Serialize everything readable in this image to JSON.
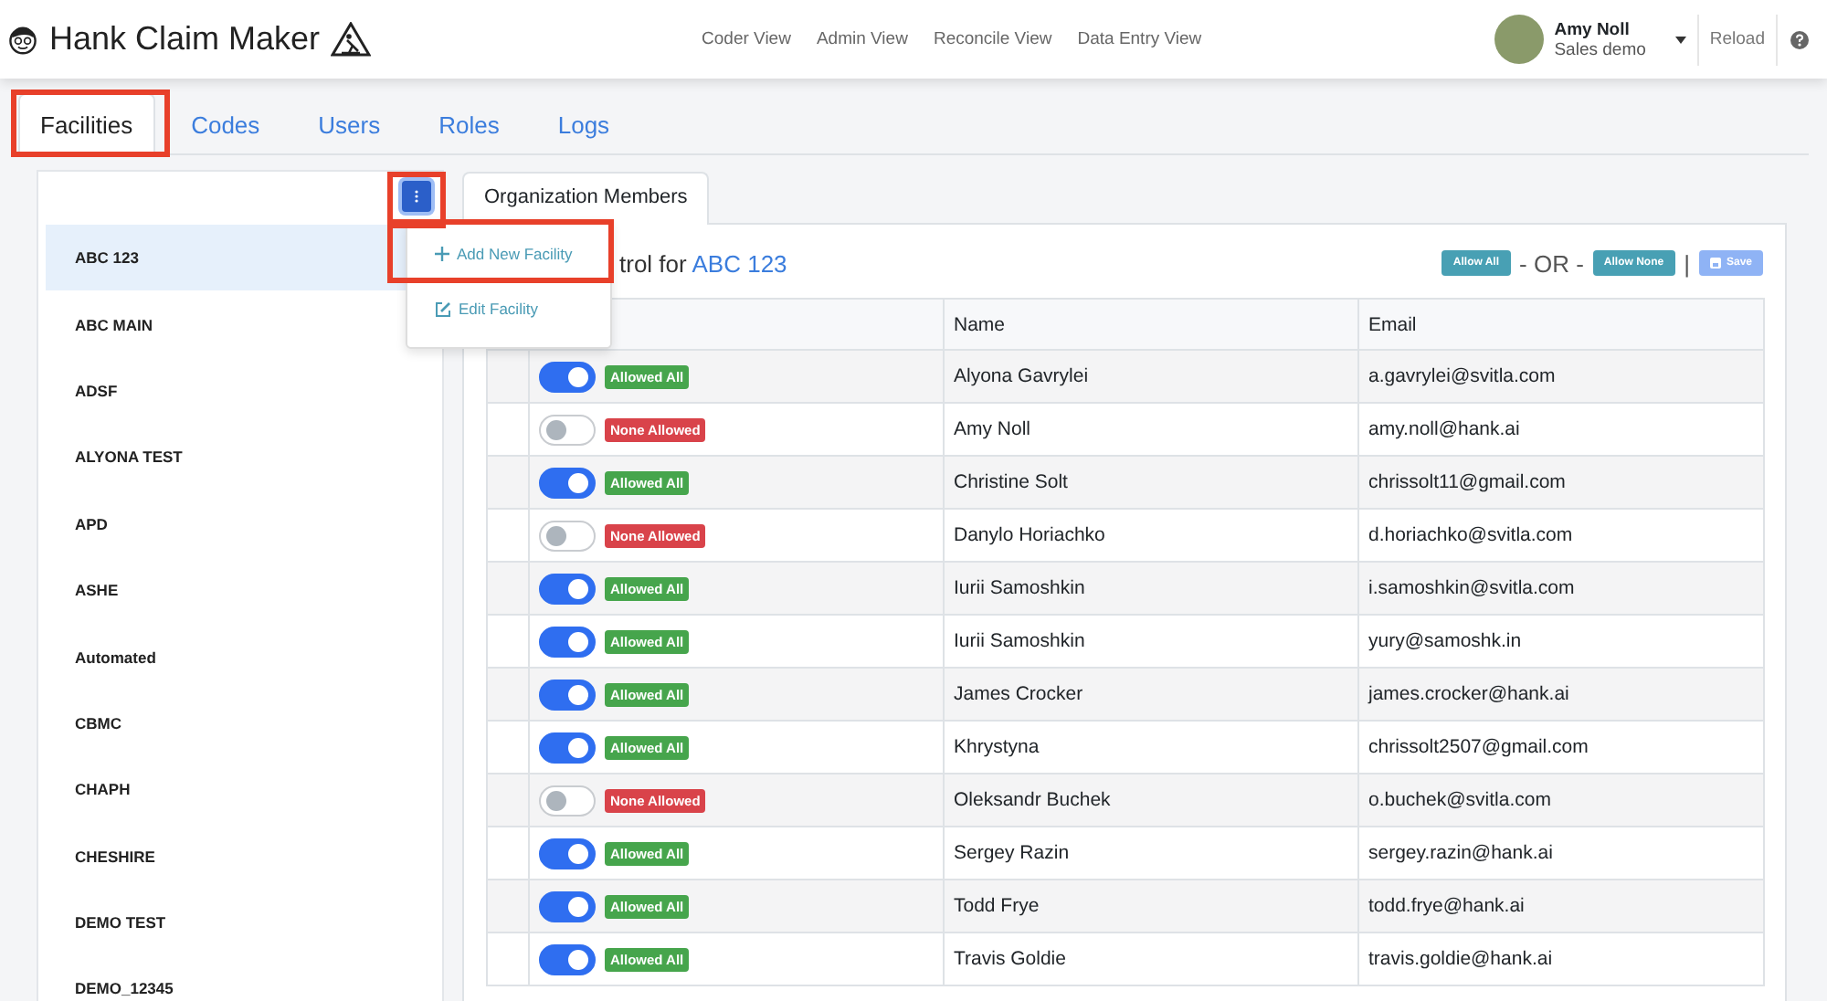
{
  "header": {
    "app_title": "Hank Claim Maker",
    "nav": [
      "Coder View",
      "Admin View",
      "Reconcile View",
      "Data Entry View"
    ],
    "user": {
      "name": "Amy Noll",
      "subtitle": "Sales demo"
    },
    "reload": "Reload"
  },
  "tabs": [
    {
      "label": "Facilities",
      "selected": true,
      "highlighted": true
    },
    {
      "label": "Codes",
      "selected": false,
      "highlighted": false
    },
    {
      "label": "Users",
      "selected": false,
      "highlighted": false
    },
    {
      "label": "Roles",
      "selected": false,
      "highlighted": false
    },
    {
      "label": "Logs",
      "selected": false,
      "highlighted": false
    }
  ],
  "facility_menu": {
    "highlighted": true,
    "expanded": true,
    "items": [
      {
        "kind": "add",
        "label": "Add New Facility",
        "highlighted": true
      },
      {
        "kind": "edit",
        "label": "Edit Facility",
        "highlighted": false
      }
    ]
  },
  "facilities": [
    {
      "name": "ABC 123",
      "selected": true
    },
    {
      "name": "ABC MAIN",
      "selected": false
    },
    {
      "name": "ADSF",
      "selected": false
    },
    {
      "name": "ALYONA TEST",
      "selected": false
    },
    {
      "name": "APD",
      "selected": false
    },
    {
      "name": "ASHE",
      "selected": false
    },
    {
      "name": "Automated",
      "selected": false
    },
    {
      "name": "CBMC",
      "selected": false
    },
    {
      "name": "CHAPH",
      "selected": false
    },
    {
      "name": "CHESHIRE",
      "selected": false
    },
    {
      "name": "DEMO TEST",
      "selected": false
    },
    {
      "name": "DEMO_12345",
      "selected": false
    }
  ],
  "panel": {
    "tab": "Organization Members",
    "title": "trol for",
    "facility": "ABC 123",
    "allow_all": "Allow All",
    "or": "- OR -",
    "separator": "|",
    "allow_none": "Allow None",
    "save": "Save",
    "save_disabled": true
  },
  "table": {
    "columns": [
      "Name",
      "Email"
    ],
    "rows": [
      {
        "on": true,
        "badge": "Allowed All",
        "name": "Alyona Gavrylei",
        "email": "a.gavrylei@svitla.com"
      },
      {
        "on": false,
        "badge": "None Allowed",
        "name": "Amy Noll",
        "email": "amy.noll@hank.ai"
      },
      {
        "on": true,
        "badge": "Allowed All",
        "name": "Christine Solt",
        "email": "chrissolt11@gmail.com"
      },
      {
        "on": false,
        "badge": "None Allowed",
        "name": "Danylo Horiachko",
        "email": "d.horiachko@svitla.com"
      },
      {
        "on": true,
        "badge": "Allowed All",
        "name": "Iurii Samoshkin",
        "email": "i.samoshkin@svitla.com"
      },
      {
        "on": true,
        "badge": "Allowed All",
        "name": "Iurii Samoshkin",
        "email": "yury@samoshk.in"
      },
      {
        "on": true,
        "badge": "Allowed All",
        "name": "James Crocker",
        "email": "james.crocker@hank.ai"
      },
      {
        "on": true,
        "badge": "Allowed All",
        "name": "Khrystyna",
        "email": "chrissolt2507@gmail.com"
      },
      {
        "on": false,
        "badge": "None Allowed",
        "name": "Oleksandr Buchek",
        "email": "o.buchek@svitla.com"
      },
      {
        "on": true,
        "badge": "Allowed All",
        "name": "Sergey Razin",
        "email": "sergey.razin@hank.ai"
      },
      {
        "on": true,
        "badge": "Allowed All",
        "name": "Todd Frye",
        "email": "todd.frye@hank.ai"
      },
      {
        "on": true,
        "badge": "Allowed All",
        "name": "Travis Goldie",
        "email": "travis.goldie@hank.ai"
      }
    ]
  }
}
